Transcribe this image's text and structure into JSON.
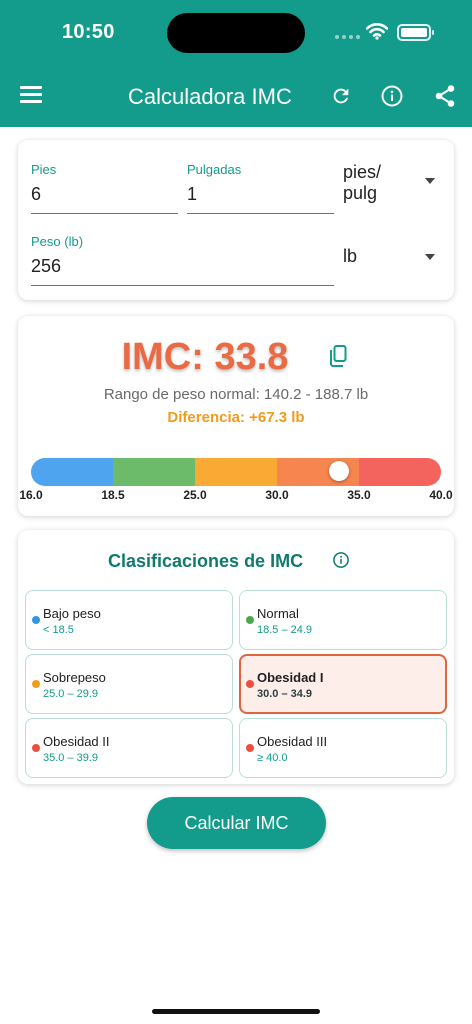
{
  "status_bar": {
    "time": "10:50"
  },
  "app_bar": {
    "title": "Calculadora IMC"
  },
  "inputs": {
    "pies": {
      "label": "Pies",
      "value": "6"
    },
    "pulgadas": {
      "label": "Pulgadas",
      "value": "1"
    },
    "length_unit": "pies/\npulg",
    "peso": {
      "label": "Peso (lb)",
      "value": "256"
    },
    "weight_unit": "lb"
  },
  "result": {
    "imc_text": "IMC: 33.8",
    "imc_value": 33.8,
    "normal_range": "Rango de peso normal: 140.2 - 188.7 lb",
    "difference": "Diferencia: +67.3 lb"
  },
  "scale": {
    "min": 16.0,
    "max": 40.0,
    "ticks": [
      "16.0",
      "18.5",
      "25.0",
      "30.0",
      "35.0",
      "40.0"
    ],
    "segment_colors": [
      "#4ea4ee",
      "#6cbb6b",
      "#fba935",
      "#f7854f",
      "#f3645f"
    ]
  },
  "classifications": {
    "title": "Clasificaciones de IMC",
    "items": [
      {
        "name": "Bajo peso",
        "range": "< 18.5",
        "color": "#2f95ea",
        "active": false
      },
      {
        "name": "Normal",
        "range": "18.5 – 24.9",
        "color": "#49a84c",
        "active": false
      },
      {
        "name": "Sobrepeso",
        "range": "25.0 – 29.9",
        "color": "#f59a1a",
        "active": false
      },
      {
        "name": "Obesidad I",
        "range": "30.0 – 34.9",
        "color": "#ec4e3f",
        "active": true
      },
      {
        "name": "Obesidad II",
        "range": "35.0 – 39.9",
        "color": "#ec4e3f",
        "active": false
      },
      {
        "name": "Obesidad III",
        "range": "≥ 40.0",
        "color": "#ec4e3f",
        "active": false
      }
    ]
  },
  "calculate_button": {
    "label": "Calcular IMC"
  }
}
